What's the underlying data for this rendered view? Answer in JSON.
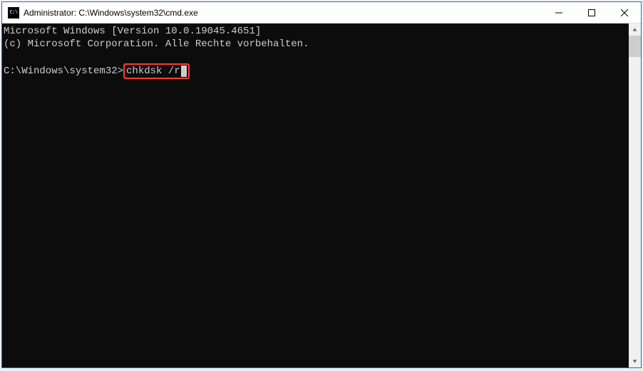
{
  "titlebar": {
    "icon_text": "C:\\",
    "title": "Administrator: C:\\Windows\\system32\\cmd.exe"
  },
  "terminal": {
    "line1": "Microsoft Windows [Version 10.0.19045.4651]",
    "line2": "(c) Microsoft Corporation. Alle Rechte vorbehalten.",
    "prompt": "C:\\Windows\\system32>",
    "command": "chkdsk /r"
  },
  "highlight": {
    "color": "#ff3b30"
  }
}
